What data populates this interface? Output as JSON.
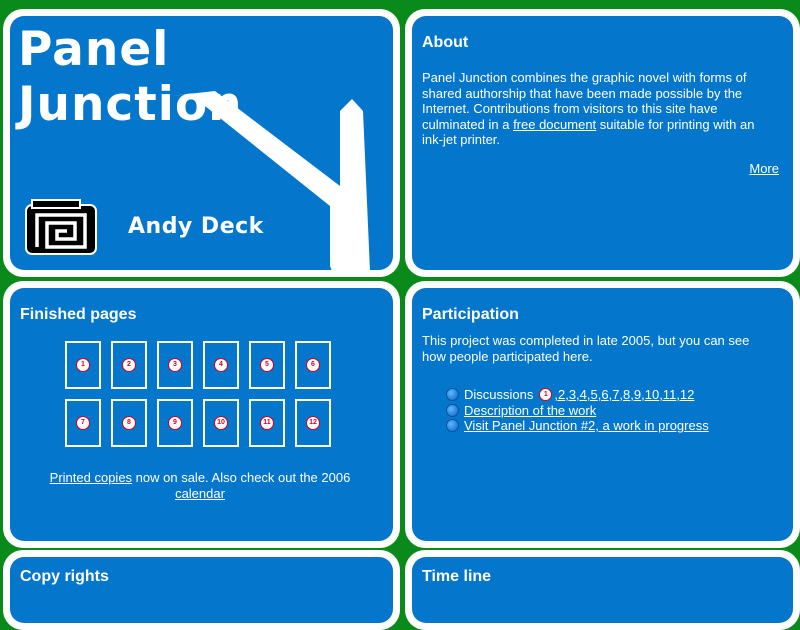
{
  "title_card": {
    "title": "Panel Junction",
    "author": "Andy Deck"
  },
  "about": {
    "heading": "About",
    "text_before_link": "Panel Junction combines the graphic novel with forms of shared authorship that have been made possible by the Internet. Contributions from visitors to this site have culminated in a ",
    "link_text": "free document",
    "text_after_link": " suitable for printing with an ink-jet printer.",
    "more_label": "More"
  },
  "finished": {
    "heading": "Finished pages",
    "pages": [
      "1",
      "2",
      "3",
      "4",
      "5",
      "6",
      "7",
      "8",
      "9",
      "10",
      "11",
      "12"
    ],
    "printed_link": "Printed copies",
    "text_middle": " now on sale. Also check out the 2006",
    "calendar_link": "calendar"
  },
  "participation": {
    "heading": "Participation",
    "intro": "This project was completed in late 2005, but you can see how people participated here.",
    "discussions_label": "Discussions",
    "first_discussion": "1",
    "other_discussions": [
      ",2",
      ",3",
      ",4",
      ",5",
      ",6",
      ",7",
      ",8",
      ",9",
      ",10",
      ",11",
      ",12"
    ],
    "description_link": "Description of the work",
    "visit_link": "Visit Panel Junction #2, a work in progress"
  },
  "copyrights": {
    "heading": "Copy rights"
  },
  "timeline": {
    "heading": "Time line"
  },
  "colors": {
    "page_background": "#0a8a1a",
    "panel_blue": "#0477cc",
    "badge_red": "#d8001a"
  },
  "icons": [
    "road-sign-arrow-icon",
    "spiral-logo-icon",
    "blue-bullet-icon",
    "number-badge-icon"
  ]
}
